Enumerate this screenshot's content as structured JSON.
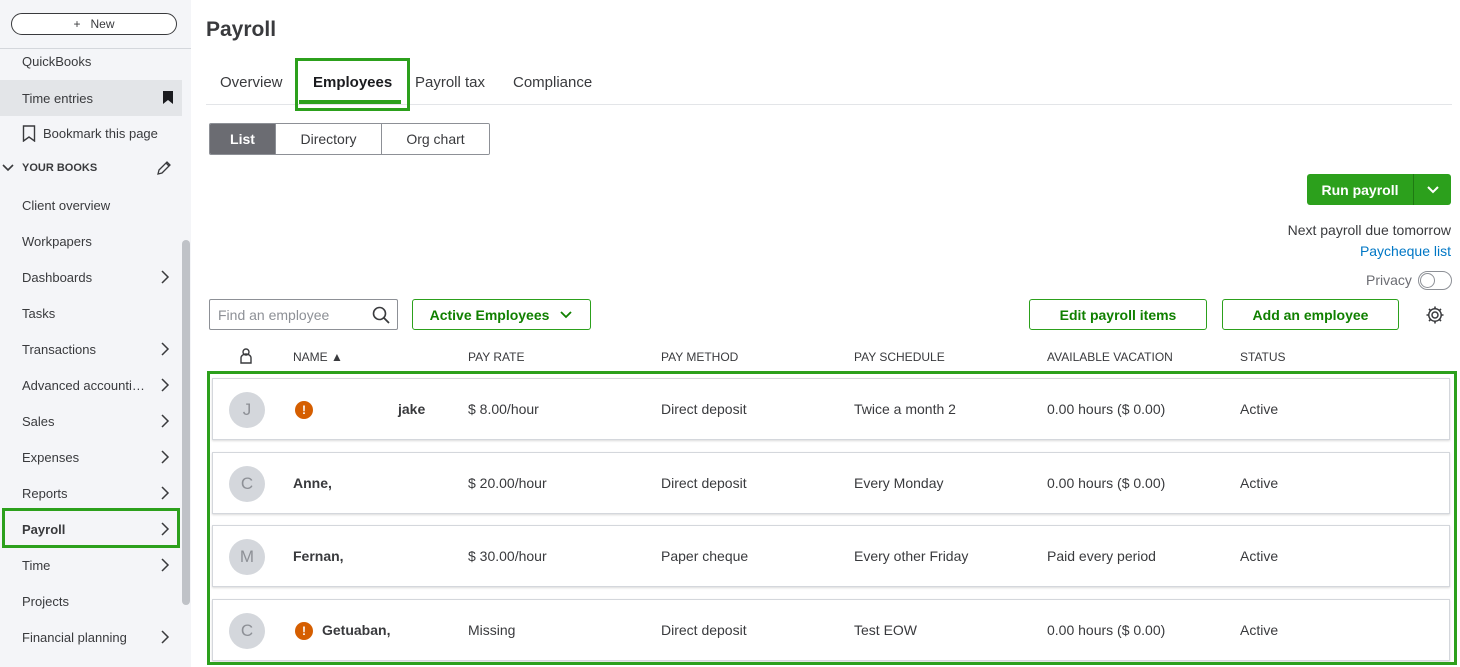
{
  "sidebar": {
    "new_label": "New",
    "items_top": [
      {
        "label": "QuickBooks"
      },
      {
        "label": "Time entries"
      },
      {
        "label": "Bookmark this page"
      }
    ],
    "section_label": "YOUR BOOKS",
    "items": [
      {
        "label": "Client overview"
      },
      {
        "label": "Workpapers"
      },
      {
        "label": "Dashboards"
      },
      {
        "label": "Tasks"
      },
      {
        "label": "Transactions"
      },
      {
        "label": "Advanced accounti…"
      },
      {
        "label": "Sales"
      },
      {
        "label": "Expenses"
      },
      {
        "label": "Reports"
      },
      {
        "label": "Payroll"
      },
      {
        "label": "Time"
      },
      {
        "label": "Projects"
      },
      {
        "label": "Financial planning"
      }
    ]
  },
  "page": {
    "title": "Payroll"
  },
  "tabs": [
    {
      "label": "Overview"
    },
    {
      "label": "Employees"
    },
    {
      "label": "Payroll tax"
    },
    {
      "label": "Compliance"
    }
  ],
  "views": [
    {
      "label": "List"
    },
    {
      "label": "Directory"
    },
    {
      "label": "Org chart"
    }
  ],
  "actions": {
    "run_payroll": "Run payroll",
    "next_due": "Next payroll due tomorrow",
    "paycheque_list": "Paycheque list",
    "privacy": "Privacy",
    "search_placeholder": "Find an employee",
    "filter": "Active Employees",
    "edit_items": "Edit payroll items",
    "add_employee": "Add an employee"
  },
  "table": {
    "columns": [
      "NAME ▲",
      "PAY RATE",
      "PAY METHOD",
      "PAY SCHEDULE",
      "AVAILABLE VACATION",
      "STATUS"
    ],
    "rows": [
      {
        "initial": "J",
        "name": "jake",
        "rate": "$ 8.00/hour",
        "method": "Direct deposit",
        "schedule": "Twice a month 2",
        "vacation": "0.00 hours ($ 0.00)",
        "status": "Active"
      },
      {
        "initial": "C",
        "name": "Anne,",
        "rate": "$ 20.00/hour",
        "method": "Direct deposit",
        "schedule": "Every Monday",
        "vacation": "0.00 hours ($ 0.00)",
        "status": "Active"
      },
      {
        "initial": "M",
        "name": "Fernan,",
        "rate": "$ 30.00/hour",
        "method": "Paper cheque",
        "schedule": "Every other Friday",
        "vacation": "Paid every period",
        "status": "Active"
      },
      {
        "initial": "C",
        "name": "Getuaban,",
        "rate": "Missing",
        "method": "Direct deposit",
        "schedule": "Test EOW",
        "vacation": "0.00 hours ($ 0.00)",
        "status": "Active"
      }
    ]
  },
  "colors": {
    "accent": "#2ca01c",
    "link": "#0077c5",
    "warning": "#d55e00"
  }
}
